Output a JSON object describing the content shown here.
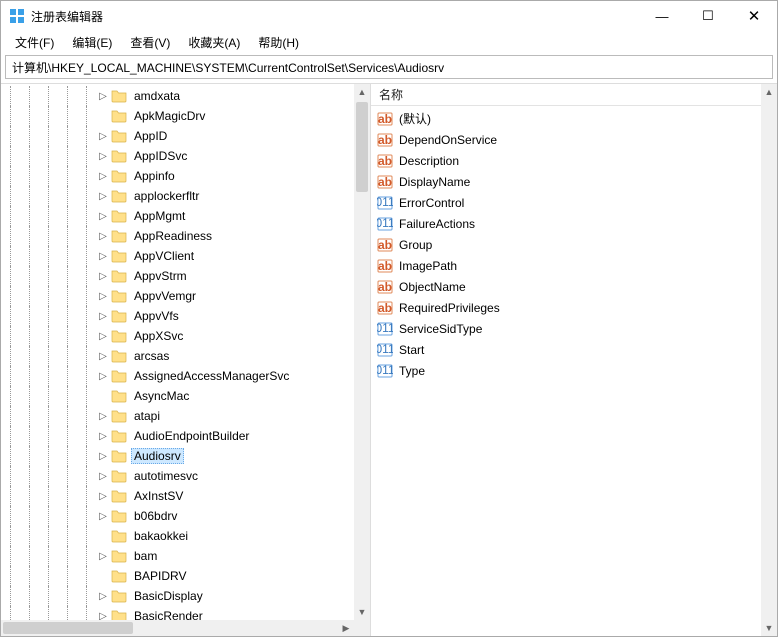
{
  "window": {
    "title": "注册表编辑器"
  },
  "menu": {
    "items": [
      "文件(F)",
      "编辑(E)",
      "查看(V)",
      "收藏夹(A)",
      "帮助(H)"
    ]
  },
  "address": {
    "path": "计算机\\HKEY_LOCAL_MACHINE\\SYSTEM\\CurrentControlSet\\Services\\Audiosrv"
  },
  "tree": {
    "depth": 5,
    "items": [
      {
        "label": "amdxata",
        "expandable": true
      },
      {
        "label": "ApkMagicDrv",
        "expandable": false
      },
      {
        "label": "AppID",
        "expandable": true
      },
      {
        "label": "AppIDSvc",
        "expandable": true
      },
      {
        "label": "Appinfo",
        "expandable": true
      },
      {
        "label": "applockerfltr",
        "expandable": true
      },
      {
        "label": "AppMgmt",
        "expandable": true
      },
      {
        "label": "AppReadiness",
        "expandable": true
      },
      {
        "label": "AppVClient",
        "expandable": true
      },
      {
        "label": "AppvStrm",
        "expandable": true
      },
      {
        "label": "AppvVemgr",
        "expandable": true
      },
      {
        "label": "AppvVfs",
        "expandable": true
      },
      {
        "label": "AppXSvc",
        "expandable": true
      },
      {
        "label": "arcsas",
        "expandable": true
      },
      {
        "label": "AssignedAccessManagerSvc",
        "expandable": true
      },
      {
        "label": "AsyncMac",
        "expandable": false
      },
      {
        "label": "atapi",
        "expandable": true
      },
      {
        "label": "AudioEndpointBuilder",
        "expandable": true
      },
      {
        "label": "Audiosrv",
        "expandable": true,
        "selected": true
      },
      {
        "label": "autotimesvc",
        "expandable": true
      },
      {
        "label": "AxInstSV",
        "expandable": true
      },
      {
        "label": "b06bdrv",
        "expandable": true
      },
      {
        "label": "bakaokkei",
        "expandable": false
      },
      {
        "label": "bam",
        "expandable": true
      },
      {
        "label": "BAPIDRV",
        "expandable": false
      },
      {
        "label": "BasicDisplay",
        "expandable": true
      },
      {
        "label": "BasicRender",
        "expandable": true
      }
    ]
  },
  "list": {
    "header": "名称",
    "items": [
      {
        "name": "(默认)",
        "type": "string"
      },
      {
        "name": "DependOnService",
        "type": "string"
      },
      {
        "name": "Description",
        "type": "string"
      },
      {
        "name": "DisplayName",
        "type": "string"
      },
      {
        "name": "ErrorControl",
        "type": "binary"
      },
      {
        "name": "FailureActions",
        "type": "binary"
      },
      {
        "name": "Group",
        "type": "string"
      },
      {
        "name": "ImagePath",
        "type": "string"
      },
      {
        "name": "ObjectName",
        "type": "string"
      },
      {
        "name": "RequiredPrivileges",
        "type": "string"
      },
      {
        "name": "ServiceSidType",
        "type": "binary"
      },
      {
        "name": "Start",
        "type": "binary"
      },
      {
        "name": "Type",
        "type": "binary"
      }
    ]
  }
}
